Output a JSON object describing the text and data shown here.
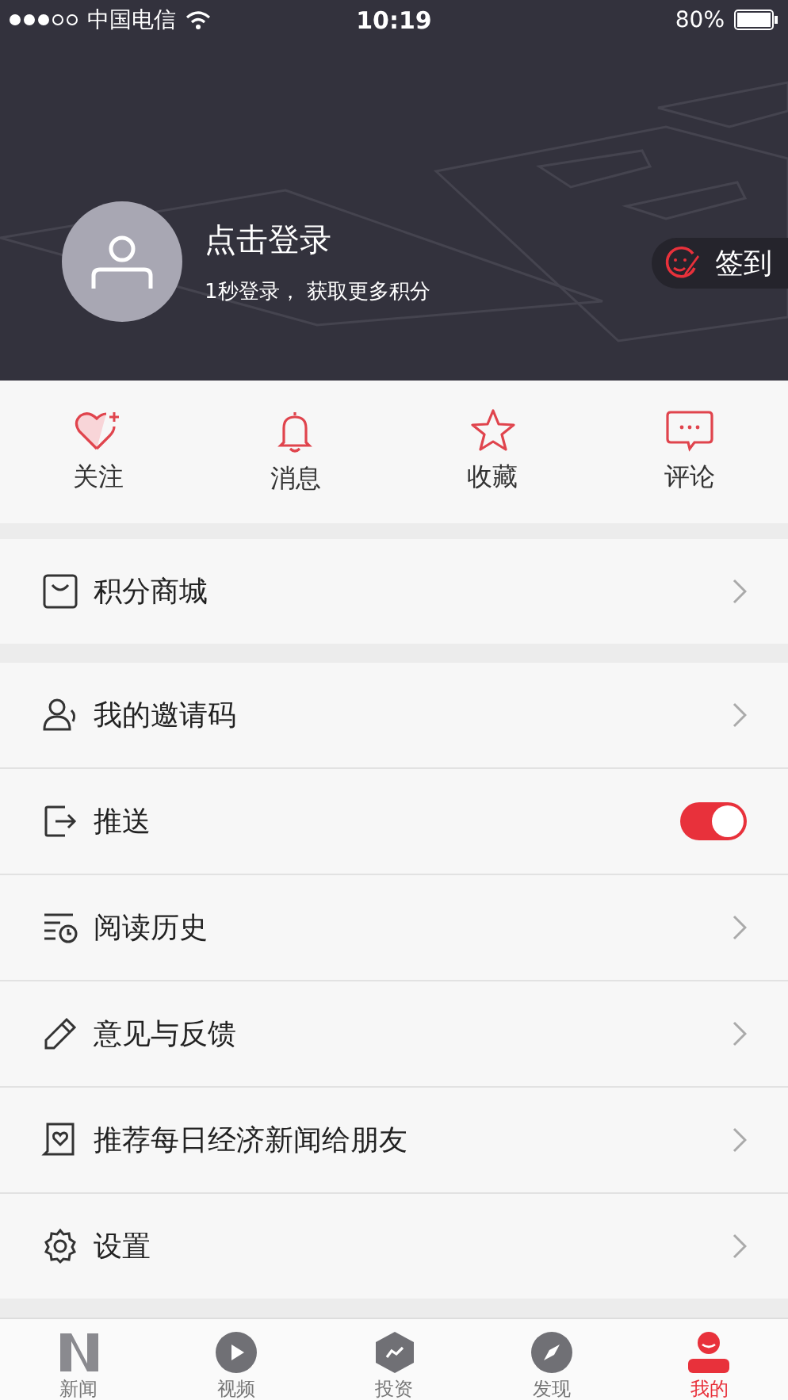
{
  "status_bar": {
    "carrier": "中国电信",
    "time": "10:19",
    "battery": "80%"
  },
  "profile": {
    "title": "点击登录",
    "subtitle": "1秒登录， 获取更多积分",
    "checkin": "签到"
  },
  "shortcuts": [
    {
      "label": "关注"
    },
    {
      "label": "消息"
    },
    {
      "label": "收藏"
    },
    {
      "label": "评论"
    }
  ],
  "menu_groups": [
    [
      {
        "label": "积分商城",
        "kind": "link"
      }
    ],
    [
      {
        "label": "我的邀请码",
        "kind": "link"
      },
      {
        "label": "推送",
        "kind": "toggle",
        "on": true
      },
      {
        "label": "阅读历史",
        "kind": "link"
      },
      {
        "label": "意见与反馈",
        "kind": "link"
      },
      {
        "label": "推荐每日经济新闻给朋友",
        "kind": "link"
      },
      {
        "label": "设置",
        "kind": "link"
      }
    ]
  ],
  "tab_bar": [
    {
      "label": "新闻",
      "selected": false
    },
    {
      "label": "视频",
      "selected": false
    },
    {
      "label": "投资",
      "selected": false
    },
    {
      "label": "发现",
      "selected": false
    },
    {
      "label": "我的",
      "selected": true
    }
  ]
}
